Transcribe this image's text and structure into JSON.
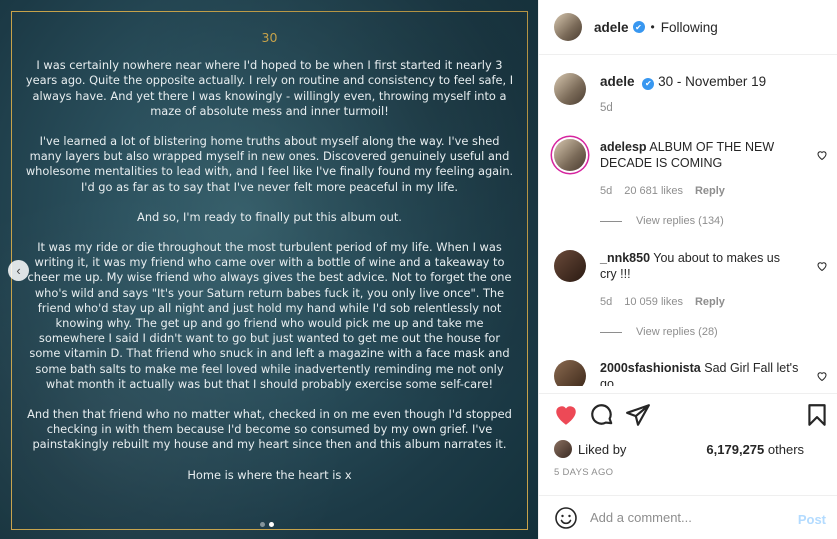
{
  "letter": {
    "heading": "30",
    "paragraphs": [
      "I was certainly nowhere near where I'd hoped to be when I first started it nearly 3 years ago. Quite the opposite actually. I rely on routine and consistency to feel safe, I always have. And yet there I was knowingly - willingly even, throwing myself into a maze of absolute mess and inner turmoil!",
      "I've learned a lot of blistering home truths about myself along the way. I've shed many layers but also wrapped myself in new ones. Discovered genuinely useful and wholesome mentalities to lead with, and I feel like I've finally found my feeling again. I'd go as far as to say that I've never felt more peaceful in my life.",
      "And so, I'm ready to finally put this album out.",
      "It was my ride or die throughout the most turbulent period of my life. When I was writing it, it was my friend who came over with a bottle of wine and a takeaway to cheer me up. My wise friend who always gives the best advice. Not to forget the one who's wild and says \"It's your Saturn return babes fuck it, you only live once\". The friend who'd stay up all night and just hold my hand while I'd sob relentlessly not knowing why. The get up and go friend who would pick me up and take me somewhere I said I didn't want to go but just wanted to get me out the house for some vitamin D. That friend who snuck in and left a magazine with a face mask and some bath salts to make me feel loved while inadvertently reminding me not only what month it actually was but that I should probably exercise some self-care!",
      "And then that friend who no matter what, checked in on me even though I'd stopped checking in with them because I'd become so consumed by my own grief. I've painstakingly rebuilt my house and my heart since then and this album narrates it.",
      "Home is where the heart is x"
    ]
  },
  "header": {
    "username": "adele",
    "separator": "•",
    "follow_label": "Following"
  },
  "caption": {
    "username": "adele",
    "text": "30 - November 19",
    "time": "5d"
  },
  "comments": [
    {
      "username": "adelesp",
      "text": "ALBUM OF THE NEW DECADE IS COMING",
      "time": "5d",
      "likes": "20 681 likes",
      "reply": "Reply",
      "view_replies": "View replies (134)"
    },
    {
      "username": "_nnk850",
      "text": "You about to makes us cry !!!",
      "time": "5d",
      "likes": "10 059 likes",
      "reply": "Reply",
      "view_replies": "View replies (28)"
    },
    {
      "username": "2000sfashionista",
      "text": "Sad Girl Fall let's go"
    }
  ],
  "likes": {
    "prefix": "Liked by",
    "count": "6,179,275",
    "suffix": "others"
  },
  "posted": "5 DAYS AGO",
  "add_comment": {
    "placeholder": "Add a comment...",
    "post_label": "Post"
  },
  "icons": {
    "verified": "✔",
    "carousel_prev": "‹"
  },
  "colors": {
    "like_red": "#ed4956",
    "gold": "#c6a24a",
    "verified_blue": "#3897f0"
  }
}
